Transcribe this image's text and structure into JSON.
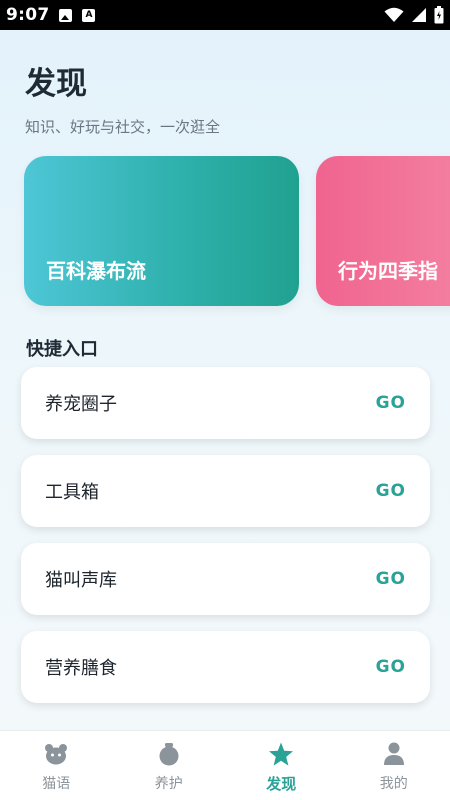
{
  "status_bar": {
    "time": "9:07",
    "icons": [
      "image-icon",
      "a-icon",
      "wifi-icon",
      "signal-icon",
      "battery-icon"
    ]
  },
  "header": {
    "title": "发现",
    "subtitle": "知识、好玩与社交，一次逛全"
  },
  "feature_cards": [
    {
      "label": "百科瀑布流",
      "color_start": "#4ec6d6",
      "color_end": "#20a190"
    },
    {
      "label": "行为四季指",
      "color_start": "#f0648f",
      "color_end": "#f58aa6"
    }
  ],
  "quick_access": {
    "title": "快捷入口",
    "go_label": "GO",
    "items": [
      {
        "label": "养宠圈子"
      },
      {
        "label": "工具箱"
      },
      {
        "label": "猫叫声库"
      },
      {
        "label": "营养膳食"
      }
    ]
  },
  "bottom_nav": {
    "items": [
      {
        "label": "猫语",
        "icon": "cat-face-icon",
        "active": false
      },
      {
        "label": "养护",
        "icon": "care-icon",
        "active": false
      },
      {
        "label": "发现",
        "icon": "star-icon",
        "active": true
      },
      {
        "label": "我的",
        "icon": "person-icon",
        "active": false
      }
    ]
  },
  "colors": {
    "accent": "#2aa296",
    "inactive": "#8c949b"
  }
}
